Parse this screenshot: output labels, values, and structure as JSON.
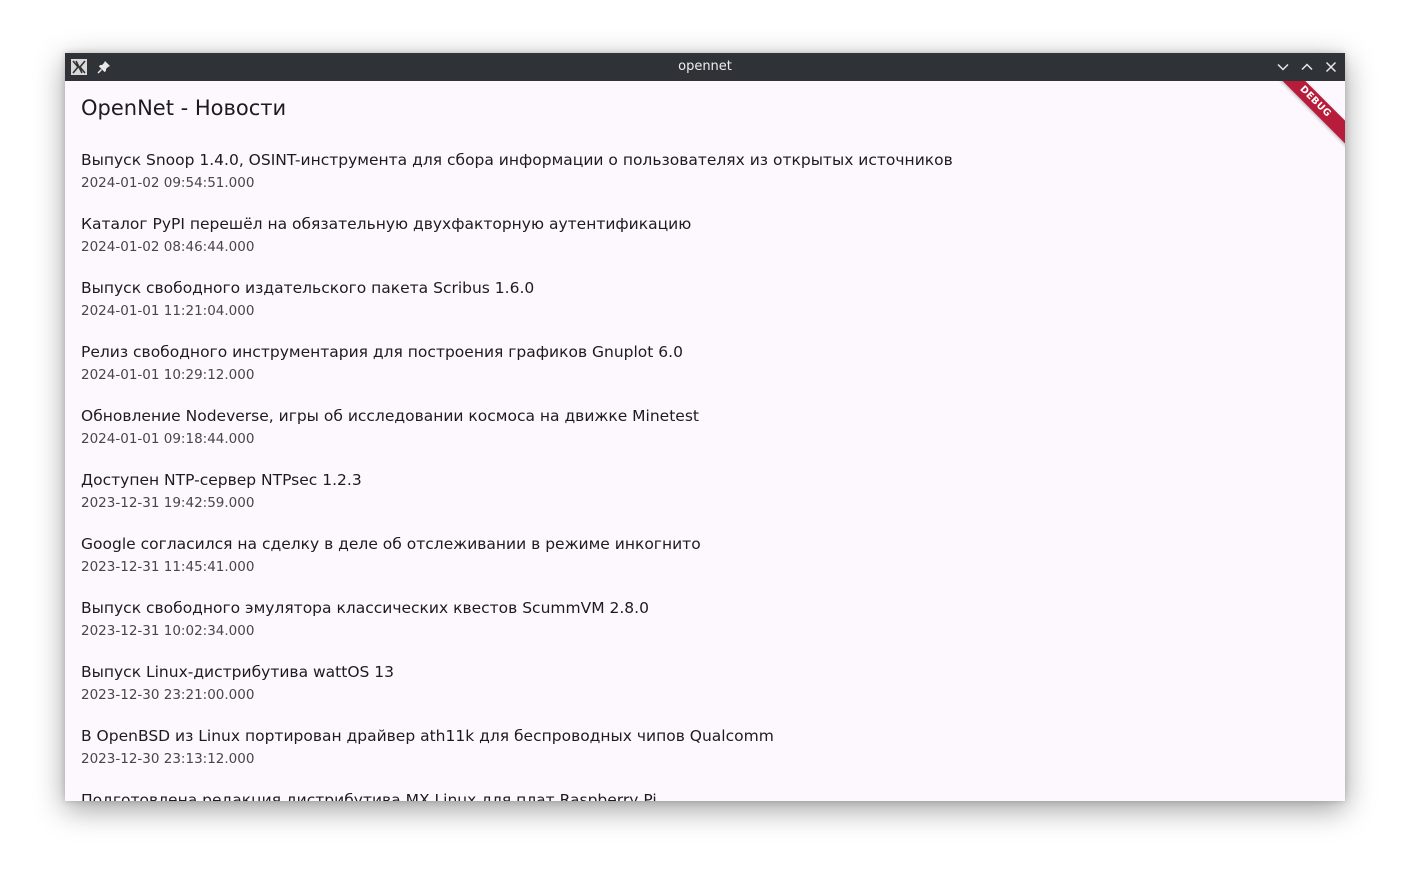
{
  "window": {
    "title": "opennet",
    "app_icon": "x11-app-icon",
    "pin_icon": "pin-icon"
  },
  "page": {
    "title": "OpenNet - Новости"
  },
  "debug_banner": "DEBUG",
  "news": [
    {
      "title": "Выпуск Snoop 1.4.0, OSINT-инструмента для сбора информации о пользователях из открытых источников",
      "date": "2024-01-02 09:54:51.000"
    },
    {
      "title": "Каталог PyPI перешёл на обязательную двухфакторную аутентификацию",
      "date": "2024-01-02 08:46:44.000"
    },
    {
      "title": "Выпуск свободного издательского пакета Scribus 1.6.0",
      "date": "2024-01-01 11:21:04.000"
    },
    {
      "title": "Релиз свободного инструментария для построения графиков Gnuplot 6.0",
      "date": "2024-01-01 10:29:12.000"
    },
    {
      "title": "Обновление Nodeverse, игры об исследовании космоса на движке Minetest",
      "date": "2024-01-01 09:18:44.000"
    },
    {
      "title": "Доступен NTP-сервер NTPsec 1.2.3",
      "date": "2023-12-31 19:42:59.000"
    },
    {
      "title": "Google согласился на сделку в деле об отслеживании в режиме инкогнито",
      "date": "2023-12-31 11:45:41.000"
    },
    {
      "title": "Выпуск свободного эмулятора классических квестов ScummVM 2.8.0",
      "date": "2023-12-31 10:02:34.000"
    },
    {
      "title": "Выпуск Linux-дистрибутива wattOS 13",
      "date": "2023-12-30 23:21:00.000"
    },
    {
      "title": "В OpenBSD из Linux портирован драйвер ath11k для беспроводных чипов Qualcomm",
      "date": "2023-12-30 23:13:12.000"
    },
    {
      "title": "Подготовлена редакция дистрибутива MX Linux для плат Raspberry Pi",
      "date": ""
    }
  ]
}
